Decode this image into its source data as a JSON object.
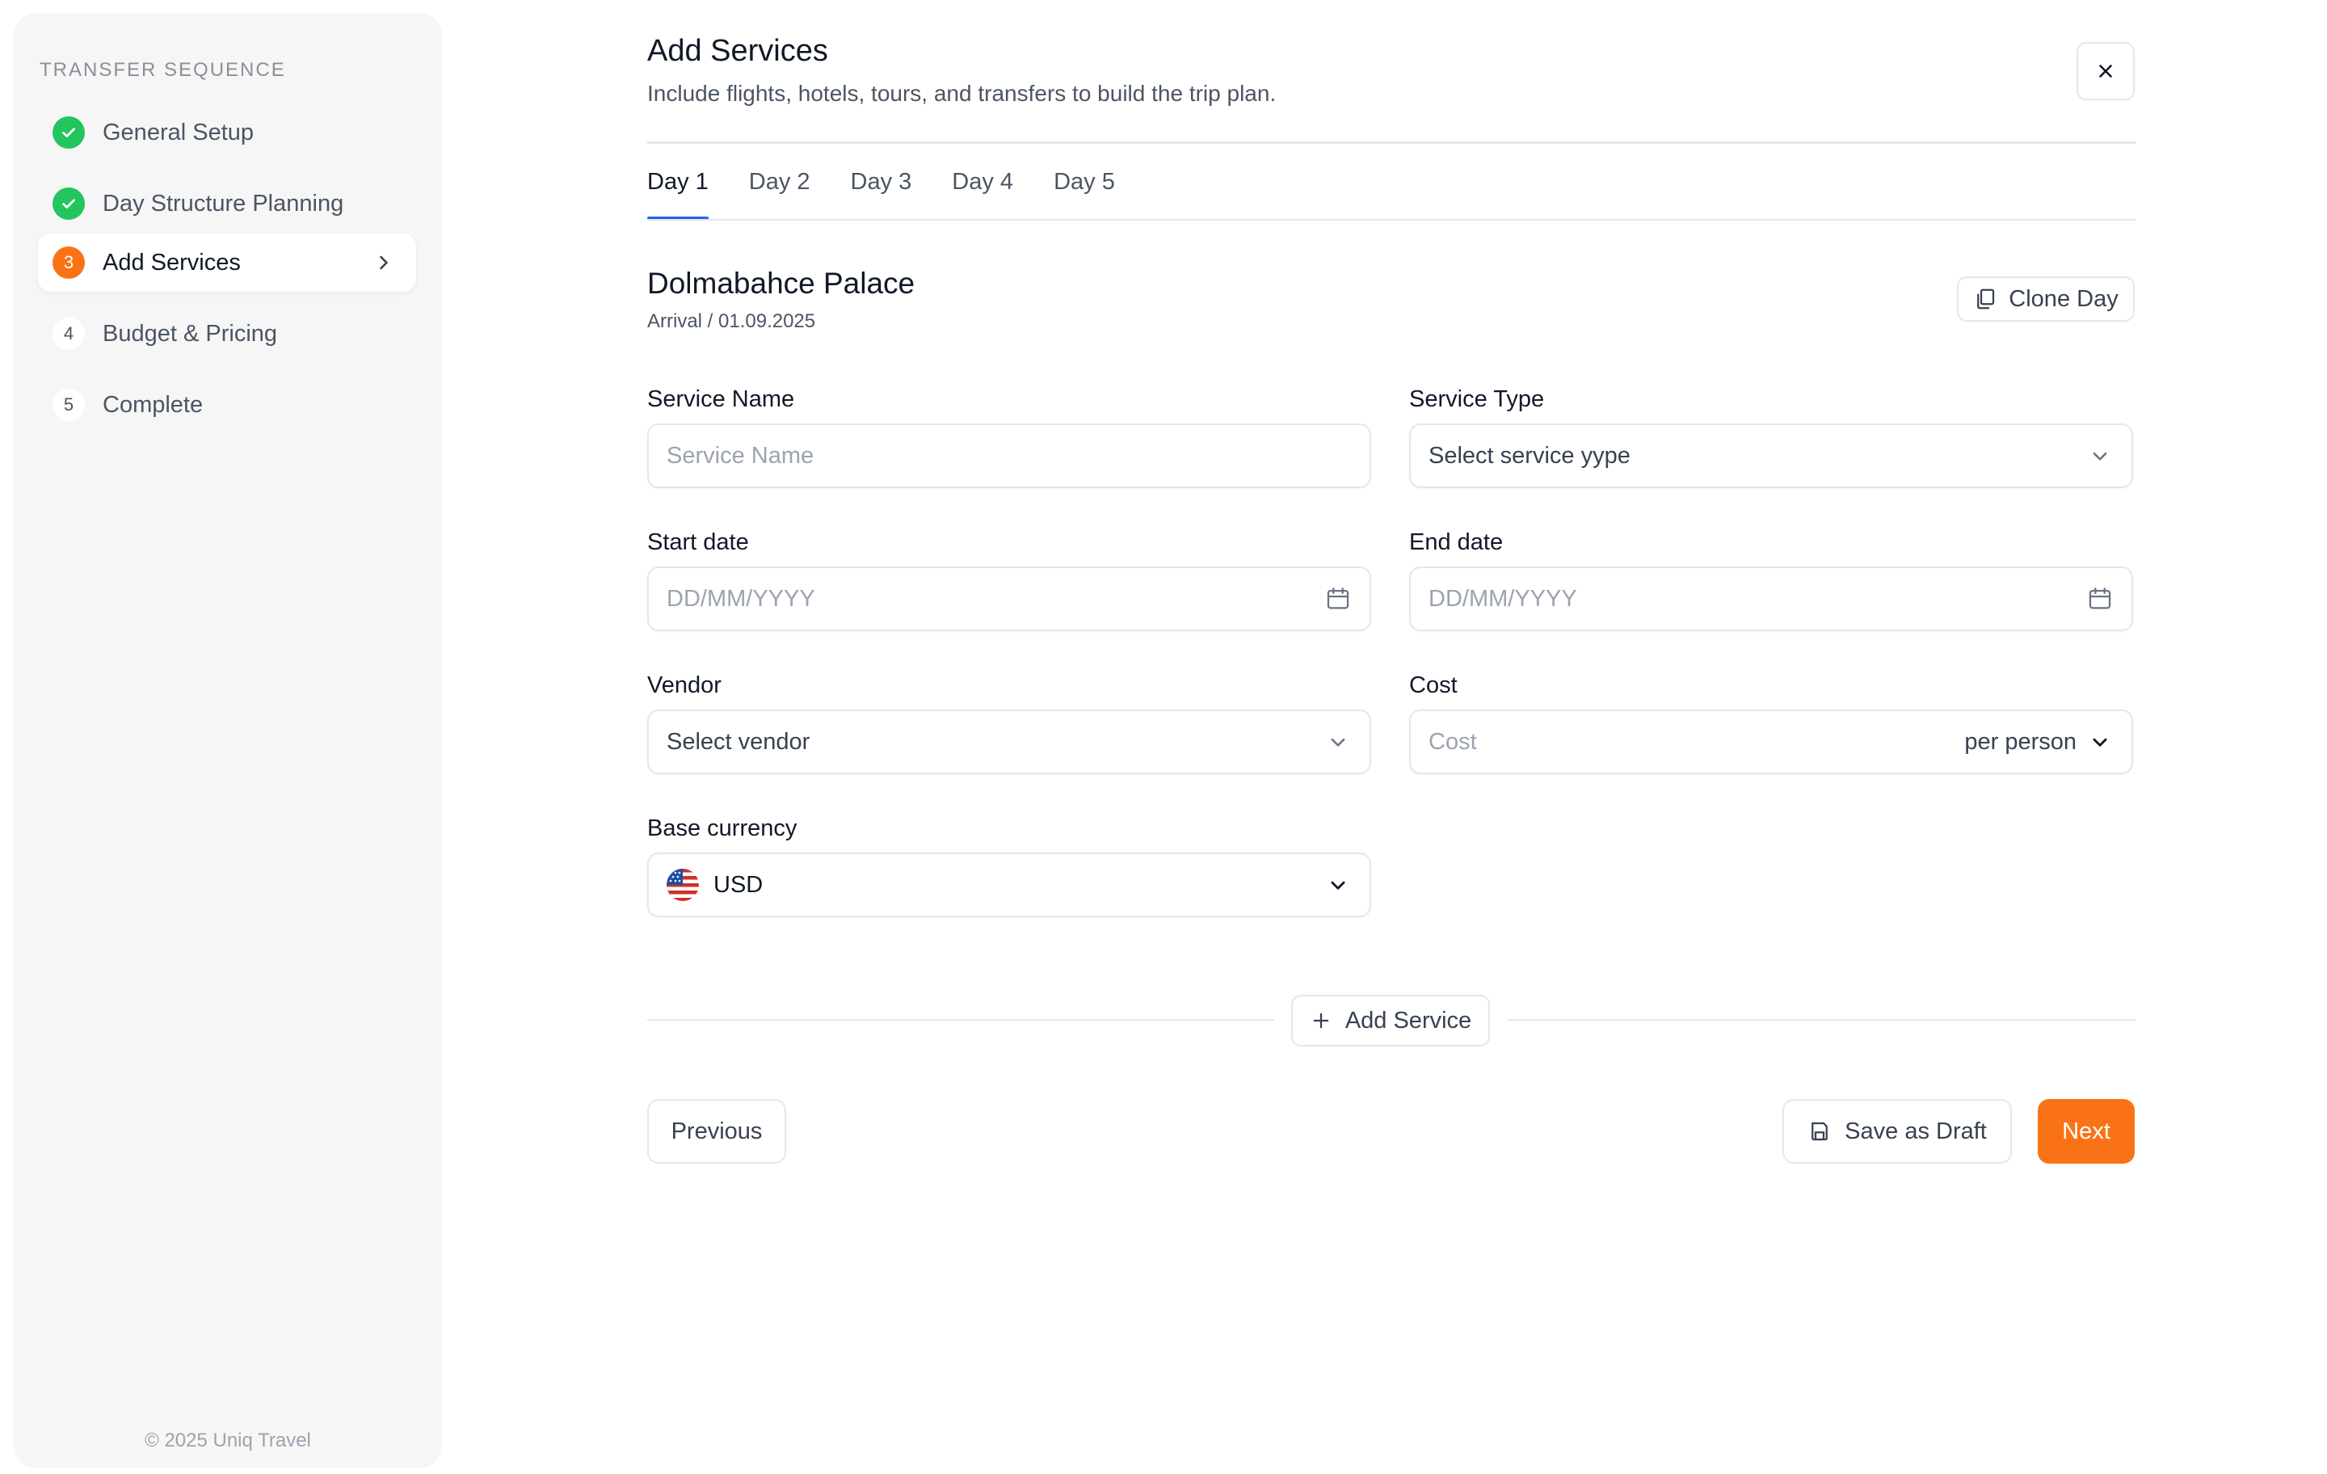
{
  "sidebar": {
    "heading": "TRANSFER SEQUENCE",
    "steps": [
      {
        "label": "General Setup",
        "number": "",
        "status": "done"
      },
      {
        "label": "Day Structure Planning",
        "number": "",
        "status": "done"
      },
      {
        "label": "Add Services",
        "number": "3",
        "status": "current"
      },
      {
        "label": "Budget & Pricing",
        "number": "4",
        "status": "pending"
      },
      {
        "label": "Complete",
        "number": "5",
        "status": "pending"
      }
    ],
    "footer": "© 2025 Uniq Travel"
  },
  "header": {
    "title": "Add Services",
    "subtitle": "Include flights, hotels, tours, and transfers to build the trip plan."
  },
  "tabs": [
    {
      "label": "Day 1",
      "active": true
    },
    {
      "label": "Day 2",
      "active": false
    },
    {
      "label": "Day 3",
      "active": false
    },
    {
      "label": "Day 4",
      "active": false
    },
    {
      "label": "Day 5",
      "active": false
    }
  ],
  "day": {
    "title": "Dolmabahce Palace",
    "subtitle": "Arrival / 01.09.2025",
    "clone_label": "Clone Day"
  },
  "form": {
    "service_name": {
      "label": "Service Name",
      "placeholder": "Service Name",
      "value": ""
    },
    "service_type": {
      "label": "Service Type",
      "value": "Select service yype"
    },
    "start_date": {
      "label": "Start date",
      "placeholder": "DD/MM/YYYY",
      "value": ""
    },
    "end_date": {
      "label": "End date",
      "placeholder": "DD/MM/YYYY",
      "value": ""
    },
    "vendor": {
      "label": "Vendor",
      "value": "Select vendor"
    },
    "cost": {
      "label": "Cost",
      "placeholder": "Cost",
      "value": "",
      "unit": "per person"
    },
    "currency": {
      "label": "Base currency",
      "value": "USD"
    }
  },
  "actions": {
    "add_service": "Add Service",
    "previous": "Previous",
    "save_draft": "Save as Draft",
    "next": "Next"
  },
  "colors": {
    "accent": "#f97316",
    "done": "#22c55e",
    "tab_indicator": "#2563eb"
  },
  "icons": {
    "close": "close-icon",
    "chevron_right": "chevron-right-icon",
    "chevron_down": "chevron-down-icon",
    "calendar": "calendar-icon",
    "copy": "copy-icon",
    "plus": "plus-icon",
    "save": "save-icon",
    "check": "check-icon",
    "flag": "us-flag-icon"
  }
}
